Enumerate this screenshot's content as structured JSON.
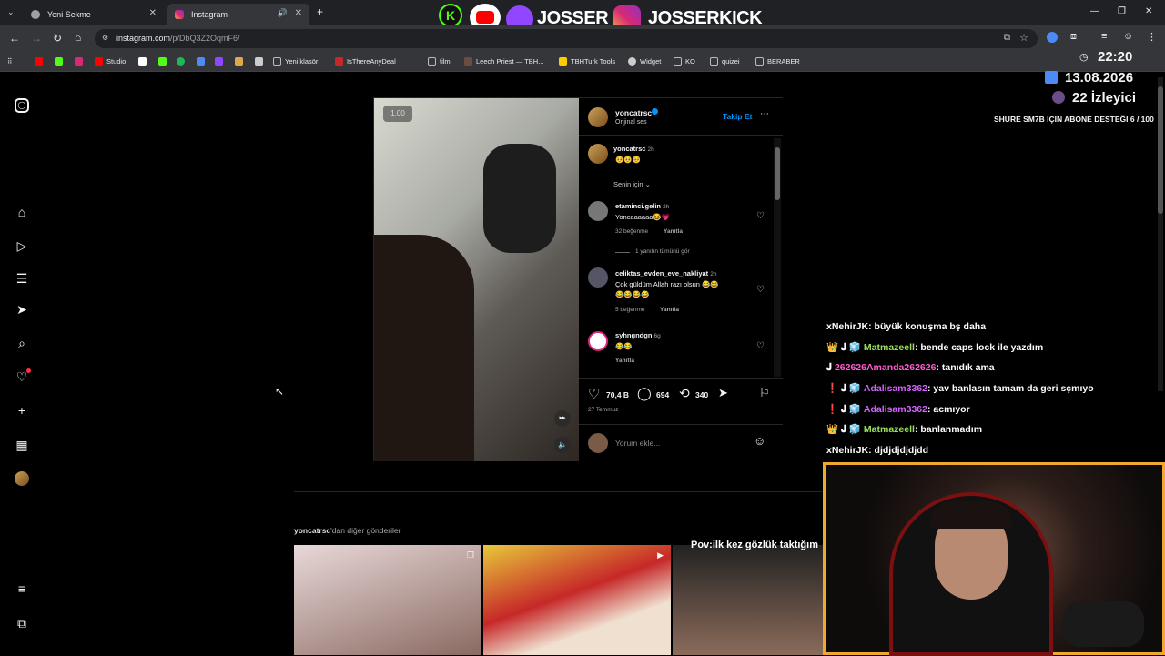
{
  "browser": {
    "tabs": [
      {
        "label": "Yeni Sekme"
      },
      {
        "label": "Instagram"
      }
    ],
    "url": {
      "host": "instagram.com",
      "path": "/p/DbQ3Z2OqmF6/"
    },
    "bookmarks": [
      "Studio",
      "Yeni klasör",
      "IsThereAnyDeal",
      "film",
      "Leech Priest — TBH...",
      "TBHTurk Tools",
      "Widget",
      "KO",
      "quizei",
      "BERABER"
    ]
  },
  "overlay": {
    "brand1": "JOSSER",
    "brand2": "JOSSERKICK",
    "time": "22:20",
    "date": "13.08.2026",
    "viewers": "22 İzleyici",
    "ticker": "SHURE SM7B İÇİN ABONE DESTEĞİ 6 / 100"
  },
  "post": {
    "speed": "1.00",
    "author": "yoncatrsc",
    "audio": "Orijinal ses",
    "follow": "Takip Et",
    "caption": {
      "user": "yoncatrsc",
      "time": "2h",
      "text": "🥺🥺🥺"
    },
    "sort": "Senin için",
    "comments": [
      {
        "user": "etaminci.gelin",
        "time": "2h",
        "text": "Yoncaaaaaa😂💗",
        "likes": "32 beğenme",
        "reply": "Yanıtla"
      },
      {
        "user": "celiktas_evden_eve_nakliyat",
        "time": "2h",
        "text": "Çok güldüm Allah razı olsun 😂😂",
        "text2": "😂😂😂😂",
        "likes": "5 beğenme",
        "reply": "Yanıtla"
      },
      {
        "user": "syhngndgn",
        "time": "6g",
        "text": "😂😂",
        "reply": "Yanıtla"
      }
    ],
    "view_replies": "1 yanıtın tümünü gör",
    "likes": "70,4 B",
    "comments_count": "694",
    "reposts": "340",
    "date": "27 Temmuz",
    "comment_placeholder": "Yorum ekle..."
  },
  "more_posts": {
    "label_user": "yoncatrsc",
    "label_rest": "'dan diğer gönderiler",
    "thumb3_caption": "Pov:ilk kez gözlük taktığım"
  },
  "chat": [
    {
      "user": "xNehirJK",
      "msg": "büyük konuşma bş daha",
      "color": "#ffffff",
      "badges": ""
    },
    {
      "user": "Matmazeell",
      "msg": "bende caps lock ile yazdım",
      "color": "#9be15d",
      "badges": "👑 𝐉 🧊"
    },
    {
      "user": "262626Amanda262626",
      "msg": "tanıdık ama",
      "color": "#ff5ccd",
      "badges": "𝐉"
    },
    {
      "user": "Adalisam3362",
      "msg": "yav banlasın tamam da geri sçmıyo",
      "color": "#d562ff",
      "badges": "❗ 𝐉 🧊"
    },
    {
      "user": "Adalisam3362",
      "msg": "acmıyor",
      "color": "#d562ff",
      "badges": "❗ 𝐉 🧊"
    },
    {
      "user": "Matmazeell",
      "msg": "banlanmadım",
      "color": "#9be15d",
      "badges": "👑 𝐉 🧊"
    },
    {
      "user": "xNehirJK",
      "msg": "djdjdjdjdjdd",
      "color": "#ffffff",
      "badges": ""
    }
  ]
}
